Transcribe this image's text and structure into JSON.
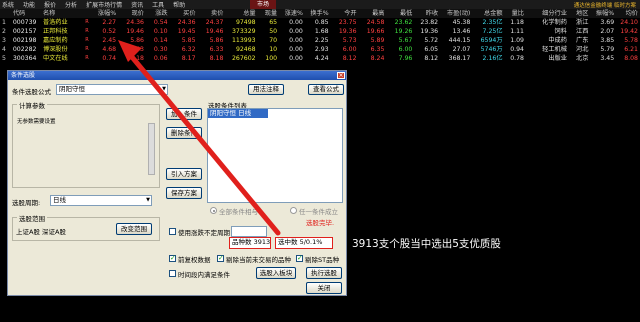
{
  "menubar": {
    "items": [
      "系统",
      "功能",
      "报价",
      "分析",
      "扩展市场行情",
      "资讯",
      "工具",
      "帮助"
    ],
    "market": "市场",
    "notice": "通达信金融终端 临时方案"
  },
  "table": {
    "headers": [
      "",
      "代码",
      "名称",
      "",
      "涨幅%",
      "现价",
      "涨跌",
      "买价",
      "卖价",
      "总量",
      "现量",
      "涨速%",
      "换手%",
      "今开",
      "最高",
      "最低",
      "昨收",
      "市盈(动)",
      "总金额",
      "量比",
      "细分行业",
      "地区",
      "振幅%",
      "均价"
    ],
    "rows": [
      {
        "idx": "1",
        "code": "000739",
        "name": "普洛药业",
        "flag": "R",
        "pct": "2.27",
        "price": "24.36",
        "chg": "0.54",
        "bid": "24.36",
        "ask": "24.37",
        "vol": "97498",
        "cur": "65",
        "spd": "0.00",
        "turn": "0.85",
        "open": "23.75",
        "high": "24.58",
        "low": "23.62",
        "prev": "23.82",
        "pe": "45.38",
        "amt": "2.35亿",
        "vr": "1.18",
        "ind": "化学制药",
        "area": "浙江",
        "amp": "3.69",
        "avg": "24.10"
      },
      {
        "idx": "2",
        "code": "002157",
        "name": "正邦科技",
        "flag": "R",
        "pct": "0.52",
        "price": "19.46",
        "chg": "0.10",
        "bid": "19.45",
        "ask": "19.46",
        "vol": "373329",
        "cur": "50",
        "spd": "0.00",
        "turn": "1.68",
        "open": "19.36",
        "high": "19.66",
        "low": "19.26",
        "prev": "19.36",
        "pe": "13.46",
        "amt": "7.25亿",
        "vr": "1.11",
        "ind": "饲料",
        "area": "江西",
        "amp": "2.07",
        "avg": "19.42"
      },
      {
        "idx": "3",
        "code": "002198",
        "name": "嘉应制药",
        "flag": "R",
        "pct": "2.45",
        "price": "5.86",
        "chg": "0.14",
        "bid": "5.85",
        "ask": "5.86",
        "vol": "113993",
        "cur": "70",
        "spd": "0.00",
        "turn": "2.25",
        "open": "5.73",
        "high": "5.89",
        "low": "5.67",
        "prev": "5.72",
        "pe": "444.15",
        "amt": "6594万",
        "vr": "1.09",
        "ind": "中成药",
        "area": "广东",
        "amp": "3.85",
        "avg": "5.78"
      },
      {
        "idx": "4",
        "code": "002282",
        "name": "博深股份",
        "flag": "R",
        "pct": "4.68",
        "price": "6.33",
        "chg": "0.30",
        "bid": "6.32",
        "ask": "6.33",
        "vol": "92468",
        "cur": "10",
        "spd": "0.00",
        "turn": "2.93",
        "open": "6.00",
        "high": "6.35",
        "low": "6.00",
        "prev": "6.05",
        "pe": "27.07",
        "amt": "5746万",
        "vr": "0.94",
        "ind": "轻工机械",
        "area": "河北",
        "amp": "5.79",
        "avg": "6.21"
      },
      {
        "idx": "5",
        "code": "300364",
        "name": "中文在线",
        "flag": "R",
        "pct": "0.74",
        "price": "8.18",
        "chg": "0.06",
        "bid": "8.17",
        "ask": "8.18",
        "vol": "267602",
        "cur": "100",
        "spd": "0.00",
        "turn": "4.24",
        "open": "8.12",
        "high": "8.24",
        "low": "7.96",
        "prev": "8.12",
        "pe": "368.17",
        "amt": "2.16亿",
        "vr": "0.78",
        "ind": "出版业",
        "area": "北京",
        "amp": "3.45",
        "avg": "8.08"
      }
    ]
  },
  "dialog": {
    "title": "条件选股",
    "close": "×",
    "formula_label": "条件选股公式",
    "formula_value": "阴阳守恒",
    "usage_button": "用法注释",
    "view_formula_button": "查看公式",
    "params_group": "计算参数",
    "params_text": "无参数需要设置",
    "list_label": "选股条件列表",
    "list_item": "阴阳守恒   日线",
    "add_button": "加入条件",
    "delete_button": "删除条件",
    "import_button": "引入方案",
    "save_button": "保存方案",
    "period_label": "选股周期:",
    "period_value": "日线",
    "all_cond_label": "全部条件相与",
    "any_cond_label": "任一条件成立",
    "done_text": "选股完毕.",
    "range_group": "选股范围",
    "range_value": "上证A股  深证A股",
    "change_range_button": "改变范围",
    "count_label": "品种数 3913",
    "selected_label": "选中数 5/0.1%",
    "use_range_label": "使用涨跌不定周期",
    "fq_label": "前复权数据",
    "remove_unlisted_label": "剔除当前未交易的品种",
    "remove_st_label": "剔除ST品种",
    "time_cond_label": "时间段内满足条件",
    "to_block_button": "选股入板块",
    "run_button": "执行选股",
    "close_button": "关闭"
  },
  "caption": "3913支个股当中选出5支优质股",
  "colors": {
    "arrow": "#e0201c",
    "highlight_box": "#e0201c",
    "up": "#ff4040",
    "down": "#3fe03f",
    "name": "#e8e839"
  },
  "icons": {
    "arrow": "arrow-annotation-icon"
  }
}
